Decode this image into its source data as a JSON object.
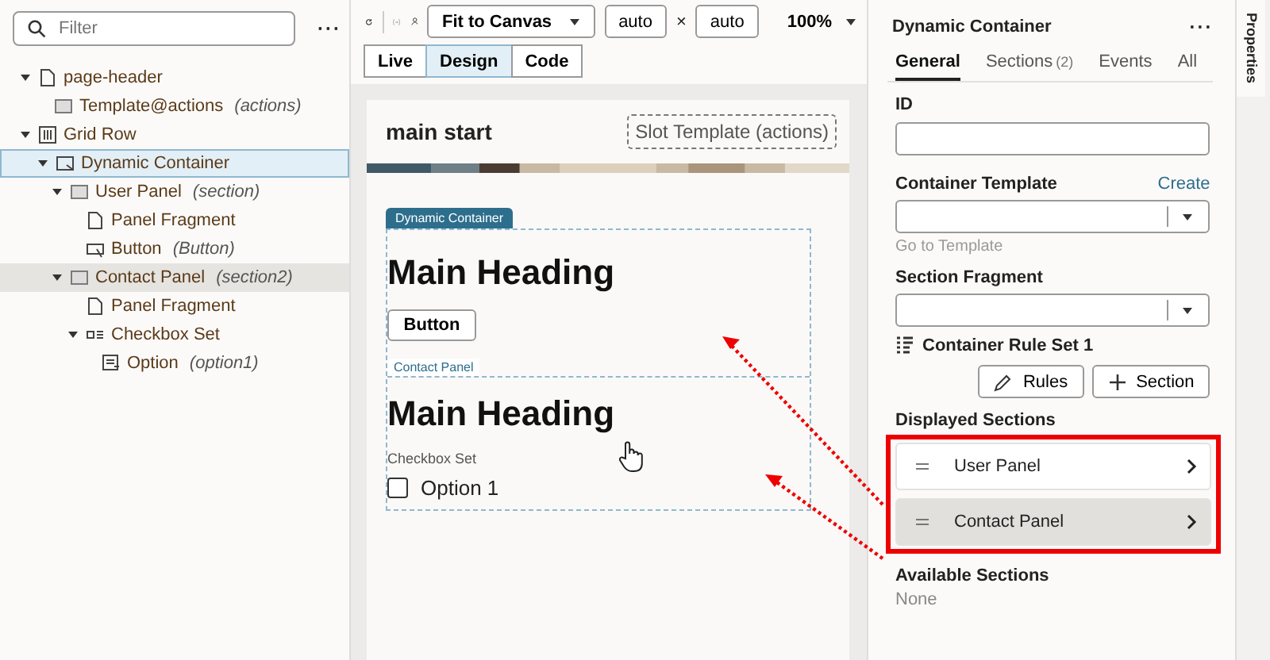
{
  "filter": {
    "placeholder": "Filter"
  },
  "left_menu": "···",
  "tree": [
    {
      "label": "page-header",
      "kind": "page",
      "expanded": true,
      "selected": false,
      "highlighted": false,
      "children": [
        {
          "label": "Template@actions",
          "note": "(actions)",
          "kind": "template",
          "selected": false,
          "highlighted": false
        }
      ]
    },
    {
      "label": "Grid Row",
      "kind": "grid",
      "expanded": true,
      "selected": false,
      "highlighted": false,
      "children": [
        {
          "label": "Dynamic Container",
          "kind": "dynamic",
          "expanded": true,
          "selected": true,
          "highlighted": false,
          "children": [
            {
              "label": "User Panel",
              "note": "(section)",
              "kind": "template",
              "expanded": true,
              "selected": false,
              "highlighted": false,
              "children": [
                {
                  "label": "Panel Fragment",
                  "kind": "page",
                  "selected": false,
                  "highlighted": false
                },
                {
                  "label": "Button",
                  "note": "(Button)",
                  "kind": "button",
                  "selected": false,
                  "highlighted": false
                }
              ]
            },
            {
              "label": "Contact Panel",
              "note": "(section2)",
              "kind": "template",
              "expanded": true,
              "selected": false,
              "highlighted": true,
              "children": [
                {
                  "label": "Panel Fragment",
                  "kind": "page",
                  "selected": false,
                  "highlighted": false
                },
                {
                  "label": "Checkbox Set",
                  "kind": "checkbox",
                  "expanded": true,
                  "selected": false,
                  "highlighted": false,
                  "children": [
                    {
                      "label": "Option",
                      "note": "(option1)",
                      "kind": "option",
                      "selected": false,
                      "highlighted": false
                    }
                  ]
                }
              ]
            }
          ]
        }
      ]
    }
  ],
  "toolbar": {
    "fit": "Fit to Canvas",
    "width": "auto",
    "times": "×",
    "height": "auto",
    "zoom": "100%"
  },
  "view_tabs": [
    {
      "label": "Live",
      "selected": false
    },
    {
      "label": "Design",
      "selected": true
    },
    {
      "label": "Code",
      "selected": false
    }
  ],
  "page": {
    "header": "main start",
    "slot": "Slot Template (actions)",
    "container_tag": "Dynamic Container",
    "section1": {
      "heading": "Main Heading",
      "button": "Button"
    },
    "section2": {
      "tag": "Contact Panel",
      "heading": "Main Heading",
      "set_label": "Checkbox Set",
      "options": [
        {
          "label": "Option 1",
          "checked": false
        }
      ]
    }
  },
  "properties": {
    "title": "Dynamic Container",
    "menu": "···",
    "tabs": [
      {
        "label": "General",
        "selected": true
      },
      {
        "label": "Sections",
        "count": "(2)",
        "selected": false
      },
      {
        "label": "Events",
        "selected": false
      },
      {
        "label": "All",
        "selected": false
      }
    ],
    "id_label": "ID",
    "template_label": "Container Template",
    "create": "Create",
    "go_to_template": "Go to Template",
    "fragment_label": "Section Fragment",
    "rule_set": "Container Rule Set 1",
    "buttons": [
      {
        "label": "Rules",
        "kind": "edit"
      },
      {
        "label": "Section",
        "kind": "add"
      }
    ],
    "displayed_title": "Displayed Sections",
    "displayed": [
      {
        "label": "User Panel",
        "selected": false
      },
      {
        "label": "Contact Panel",
        "selected": true
      }
    ],
    "available_title": "Available Sections",
    "available_none": "None"
  },
  "side_tab": "Properties"
}
